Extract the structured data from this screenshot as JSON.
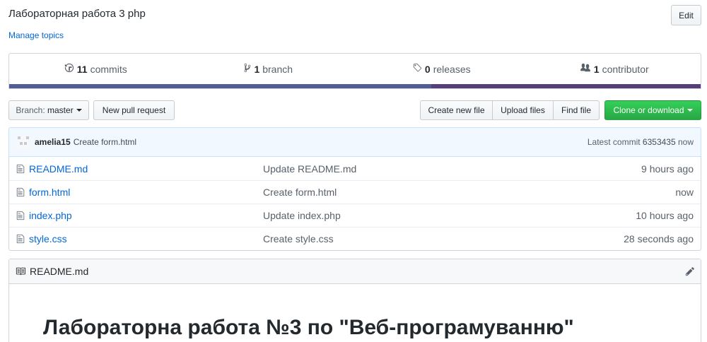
{
  "repo": {
    "description": "Лабораторная работа 3 php",
    "manage_topics": "Manage topics",
    "edit_label": "Edit"
  },
  "summary": {
    "commits_count": "11",
    "commits_label": "commits",
    "branch_count": "1",
    "branch_label": "branch",
    "releases_count": "0",
    "releases_label": "releases",
    "contributors_count": "1",
    "contributors_label": "contributor",
    "lang_colors": [
      "#4F5D95",
      "#563d7c"
    ]
  },
  "toolbar": {
    "branch_prefix": "Branch:",
    "branch_name": "master",
    "new_pr": "New pull request",
    "create_file": "Create new file",
    "upload_files": "Upload files",
    "find_file": "Find file",
    "clone": "Clone or download"
  },
  "commit": {
    "author": "amelia15",
    "message": "Create form.html",
    "latest_label": "Latest commit",
    "sha": "6353435",
    "age": "now"
  },
  "files": [
    {
      "name": "README.md",
      "message": "Update README.md",
      "age": "9 hours ago"
    },
    {
      "name": "form.html",
      "message": "Create form.html",
      "age": "now"
    },
    {
      "name": "index.php",
      "message": "Update index.php",
      "age": "10 hours ago"
    },
    {
      "name": "style.css",
      "message": "Create style.css",
      "age": "28 seconds ago"
    }
  ],
  "readme": {
    "filename": "README.md",
    "heading": "Лабораторна работа №3 по \"Веб-програмуванню\""
  },
  "icons": {
    "commits": "history-icon",
    "branch": "git-branch-icon",
    "releases": "tag-icon",
    "contributors": "people-icon",
    "file": "file-icon",
    "readme": "book-icon",
    "edit": "pencil-icon"
  }
}
